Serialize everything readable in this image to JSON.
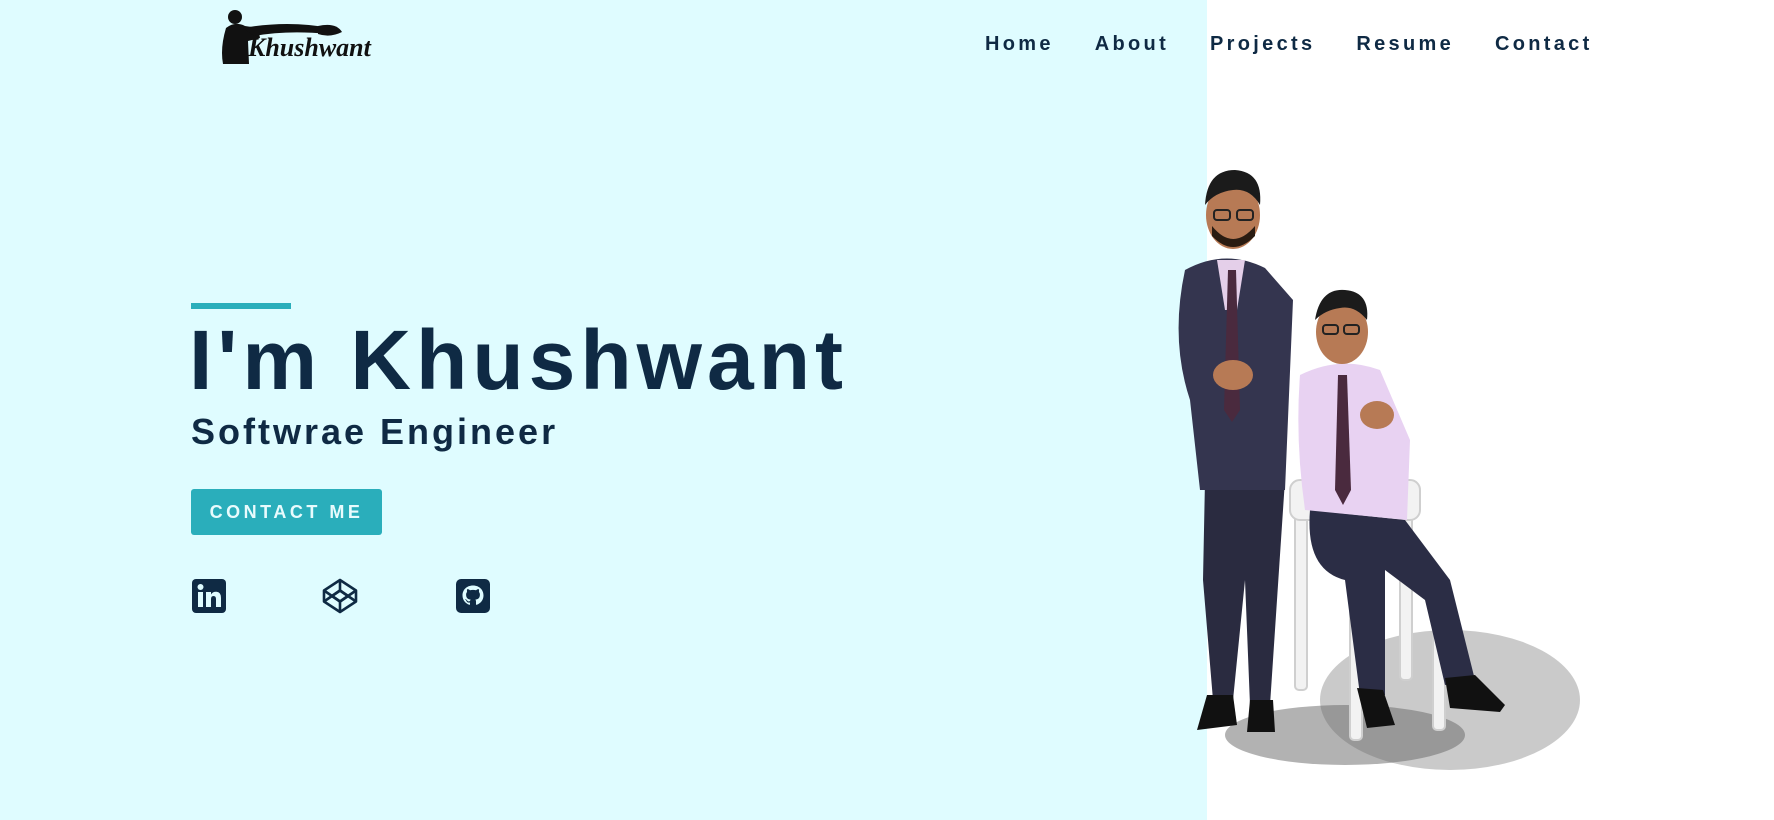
{
  "header": {
    "logo_icon": "khushwant-signature-logo",
    "logo_text": "Khushwant",
    "nav": [
      {
        "label": "Home"
      },
      {
        "label": "About"
      },
      {
        "label": "Projects"
      },
      {
        "label": "Resume"
      },
      {
        "label": "Contact"
      }
    ]
  },
  "hero": {
    "title": "I'm Khushwant",
    "subtitle": "Softwrae Engineer",
    "cta_label": "CONTACT ME"
  },
  "social": [
    {
      "icon": "linkedin-icon"
    },
    {
      "icon": "codepen-icon"
    },
    {
      "icon": "github-icon"
    }
  ],
  "colors": {
    "left_background": "#dffcff",
    "right_background": "#ffffff",
    "accent": "#2aaebb",
    "text_dark": "#0f2a44"
  }
}
